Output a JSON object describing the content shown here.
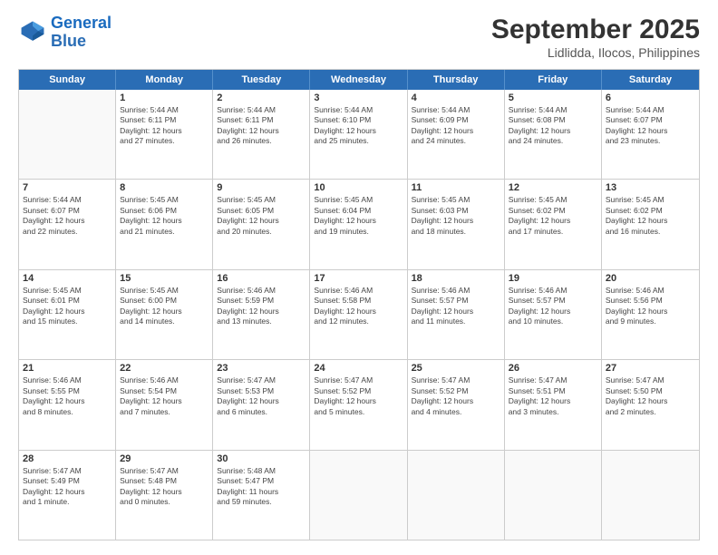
{
  "logo": {
    "line1": "General",
    "line2": "Blue"
  },
  "title": "September 2025",
  "subtitle": "Lidlidda, Ilocos, Philippines",
  "days": [
    "Sunday",
    "Monday",
    "Tuesday",
    "Wednesday",
    "Thursday",
    "Friday",
    "Saturday"
  ],
  "weeks": [
    [
      {
        "day": "",
        "info": ""
      },
      {
        "day": "1",
        "info": "Sunrise: 5:44 AM\nSunset: 6:11 PM\nDaylight: 12 hours\nand 27 minutes."
      },
      {
        "day": "2",
        "info": "Sunrise: 5:44 AM\nSunset: 6:11 PM\nDaylight: 12 hours\nand 26 minutes."
      },
      {
        "day": "3",
        "info": "Sunrise: 5:44 AM\nSunset: 6:10 PM\nDaylight: 12 hours\nand 25 minutes."
      },
      {
        "day": "4",
        "info": "Sunrise: 5:44 AM\nSunset: 6:09 PM\nDaylight: 12 hours\nand 24 minutes."
      },
      {
        "day": "5",
        "info": "Sunrise: 5:44 AM\nSunset: 6:08 PM\nDaylight: 12 hours\nand 24 minutes."
      },
      {
        "day": "6",
        "info": "Sunrise: 5:44 AM\nSunset: 6:07 PM\nDaylight: 12 hours\nand 23 minutes."
      }
    ],
    [
      {
        "day": "7",
        "info": "Sunrise: 5:44 AM\nSunset: 6:07 PM\nDaylight: 12 hours\nand 22 minutes."
      },
      {
        "day": "8",
        "info": "Sunrise: 5:45 AM\nSunset: 6:06 PM\nDaylight: 12 hours\nand 21 minutes."
      },
      {
        "day": "9",
        "info": "Sunrise: 5:45 AM\nSunset: 6:05 PM\nDaylight: 12 hours\nand 20 minutes."
      },
      {
        "day": "10",
        "info": "Sunrise: 5:45 AM\nSunset: 6:04 PM\nDaylight: 12 hours\nand 19 minutes."
      },
      {
        "day": "11",
        "info": "Sunrise: 5:45 AM\nSunset: 6:03 PM\nDaylight: 12 hours\nand 18 minutes."
      },
      {
        "day": "12",
        "info": "Sunrise: 5:45 AM\nSunset: 6:02 PM\nDaylight: 12 hours\nand 17 minutes."
      },
      {
        "day": "13",
        "info": "Sunrise: 5:45 AM\nSunset: 6:02 PM\nDaylight: 12 hours\nand 16 minutes."
      }
    ],
    [
      {
        "day": "14",
        "info": "Sunrise: 5:45 AM\nSunset: 6:01 PM\nDaylight: 12 hours\nand 15 minutes."
      },
      {
        "day": "15",
        "info": "Sunrise: 5:45 AM\nSunset: 6:00 PM\nDaylight: 12 hours\nand 14 minutes."
      },
      {
        "day": "16",
        "info": "Sunrise: 5:46 AM\nSunset: 5:59 PM\nDaylight: 12 hours\nand 13 minutes."
      },
      {
        "day": "17",
        "info": "Sunrise: 5:46 AM\nSunset: 5:58 PM\nDaylight: 12 hours\nand 12 minutes."
      },
      {
        "day": "18",
        "info": "Sunrise: 5:46 AM\nSunset: 5:57 PM\nDaylight: 12 hours\nand 11 minutes."
      },
      {
        "day": "19",
        "info": "Sunrise: 5:46 AM\nSunset: 5:57 PM\nDaylight: 12 hours\nand 10 minutes."
      },
      {
        "day": "20",
        "info": "Sunrise: 5:46 AM\nSunset: 5:56 PM\nDaylight: 12 hours\nand 9 minutes."
      }
    ],
    [
      {
        "day": "21",
        "info": "Sunrise: 5:46 AM\nSunset: 5:55 PM\nDaylight: 12 hours\nand 8 minutes."
      },
      {
        "day": "22",
        "info": "Sunrise: 5:46 AM\nSunset: 5:54 PM\nDaylight: 12 hours\nand 7 minutes."
      },
      {
        "day": "23",
        "info": "Sunrise: 5:47 AM\nSunset: 5:53 PM\nDaylight: 12 hours\nand 6 minutes."
      },
      {
        "day": "24",
        "info": "Sunrise: 5:47 AM\nSunset: 5:52 PM\nDaylight: 12 hours\nand 5 minutes."
      },
      {
        "day": "25",
        "info": "Sunrise: 5:47 AM\nSunset: 5:52 PM\nDaylight: 12 hours\nand 4 minutes."
      },
      {
        "day": "26",
        "info": "Sunrise: 5:47 AM\nSunset: 5:51 PM\nDaylight: 12 hours\nand 3 minutes."
      },
      {
        "day": "27",
        "info": "Sunrise: 5:47 AM\nSunset: 5:50 PM\nDaylight: 12 hours\nand 2 minutes."
      }
    ],
    [
      {
        "day": "28",
        "info": "Sunrise: 5:47 AM\nSunset: 5:49 PM\nDaylight: 12 hours\nand 1 minute."
      },
      {
        "day": "29",
        "info": "Sunrise: 5:47 AM\nSunset: 5:48 PM\nDaylight: 12 hours\nand 0 minutes."
      },
      {
        "day": "30",
        "info": "Sunrise: 5:48 AM\nSunset: 5:47 PM\nDaylight: 11 hours\nand 59 minutes."
      },
      {
        "day": "",
        "info": ""
      },
      {
        "day": "",
        "info": ""
      },
      {
        "day": "",
        "info": ""
      },
      {
        "day": "",
        "info": ""
      }
    ]
  ]
}
